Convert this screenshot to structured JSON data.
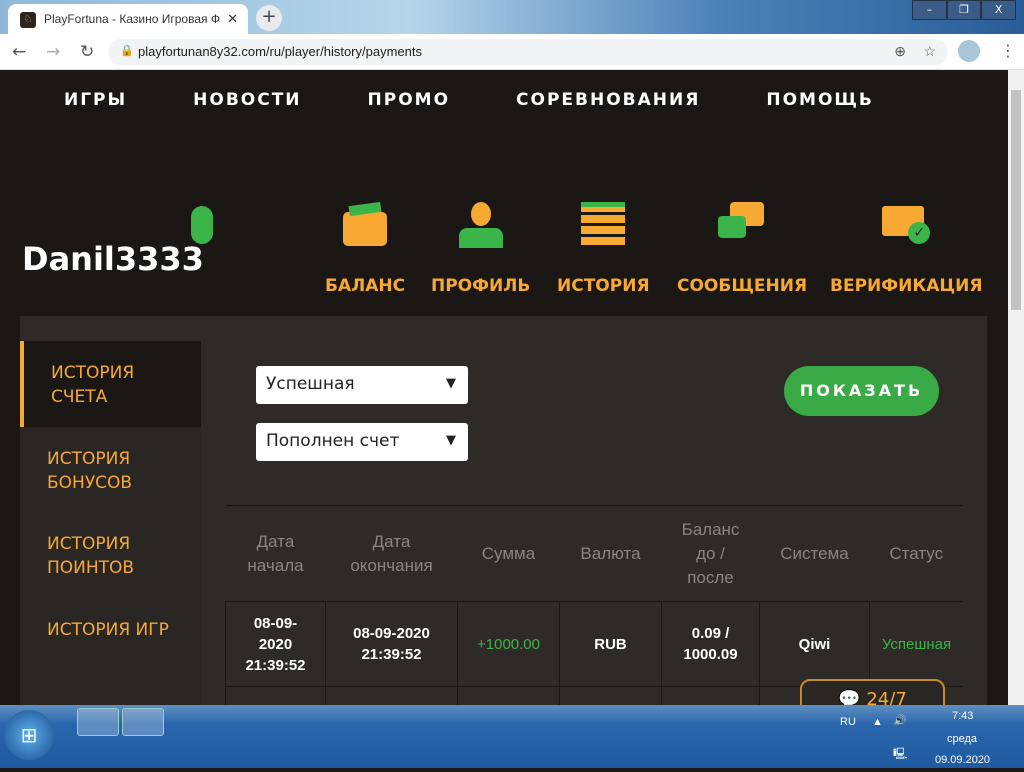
{
  "browser": {
    "tab_title": "PlayFortuna - Казино Игровая Ф",
    "url": "playfortunan8y32.com/ru/player/history/payments"
  },
  "topnav": [
    "ИГРЫ",
    "НОВОСТИ",
    "ПРОМО",
    "СОРЕВНОВАНИЯ",
    "ПОМОЩЬ"
  ],
  "username": "Danil3333",
  "profile_tabs": [
    {
      "label": "БАЛАНС",
      "icon": "wallet-icon"
    },
    {
      "label": "ПРОФИЛЬ",
      "icon": "user-icon"
    },
    {
      "label": "ИСТОРИЯ",
      "icon": "notepad-icon",
      "active": true
    },
    {
      "label": "СООБЩЕНИЯ",
      "icon": "chat-icon"
    },
    {
      "label": "ВЕРИФИКАЦИЯ",
      "icon": "id-card-icon"
    }
  ],
  "sidebar": [
    {
      "label1": "ИСТОРИЯ",
      "label2": "СЧЕТА",
      "active": true
    },
    {
      "label1": "ИСТОРИЯ",
      "label2": "БОНУСОВ"
    },
    {
      "label1": "ИСТОРИЯ",
      "label2": "ПОИНТОВ"
    },
    {
      "label1": "ИСТОРИЯ ИГР",
      "label2": ""
    }
  ],
  "filters": {
    "status": "Успешная",
    "type": "Пополнен счет",
    "show_label": "ПОКАЗАТЬ"
  },
  "table": {
    "headers": [
      [
        "Дата",
        "начала"
      ],
      [
        "Дата",
        "окончания"
      ],
      [
        "Сумма",
        ""
      ],
      [
        "Валюта",
        ""
      ],
      [
        "Баланс",
        "до /",
        "после"
      ],
      [
        "Система",
        ""
      ],
      [
        "Статус",
        ""
      ]
    ],
    "rows": [
      {
        "start": [
          "08-09-",
          "2020",
          "21:39:52"
        ],
        "end": [
          "08-09-2020",
          "21:39:52"
        ],
        "amount": "+1000.00",
        "currency": "RUB",
        "balance": [
          "0.09 /",
          "1000.09"
        ],
        "system": "Qiwi",
        "status": "Успешная"
      }
    ]
  },
  "chat_label": "24/7",
  "taskbar": {
    "lang": "RU",
    "time": "7:43",
    "day": "среда",
    "date": "09.09.2020"
  },
  "colors": {
    "accent": "#f7a933",
    "green": "#3bb54a"
  }
}
